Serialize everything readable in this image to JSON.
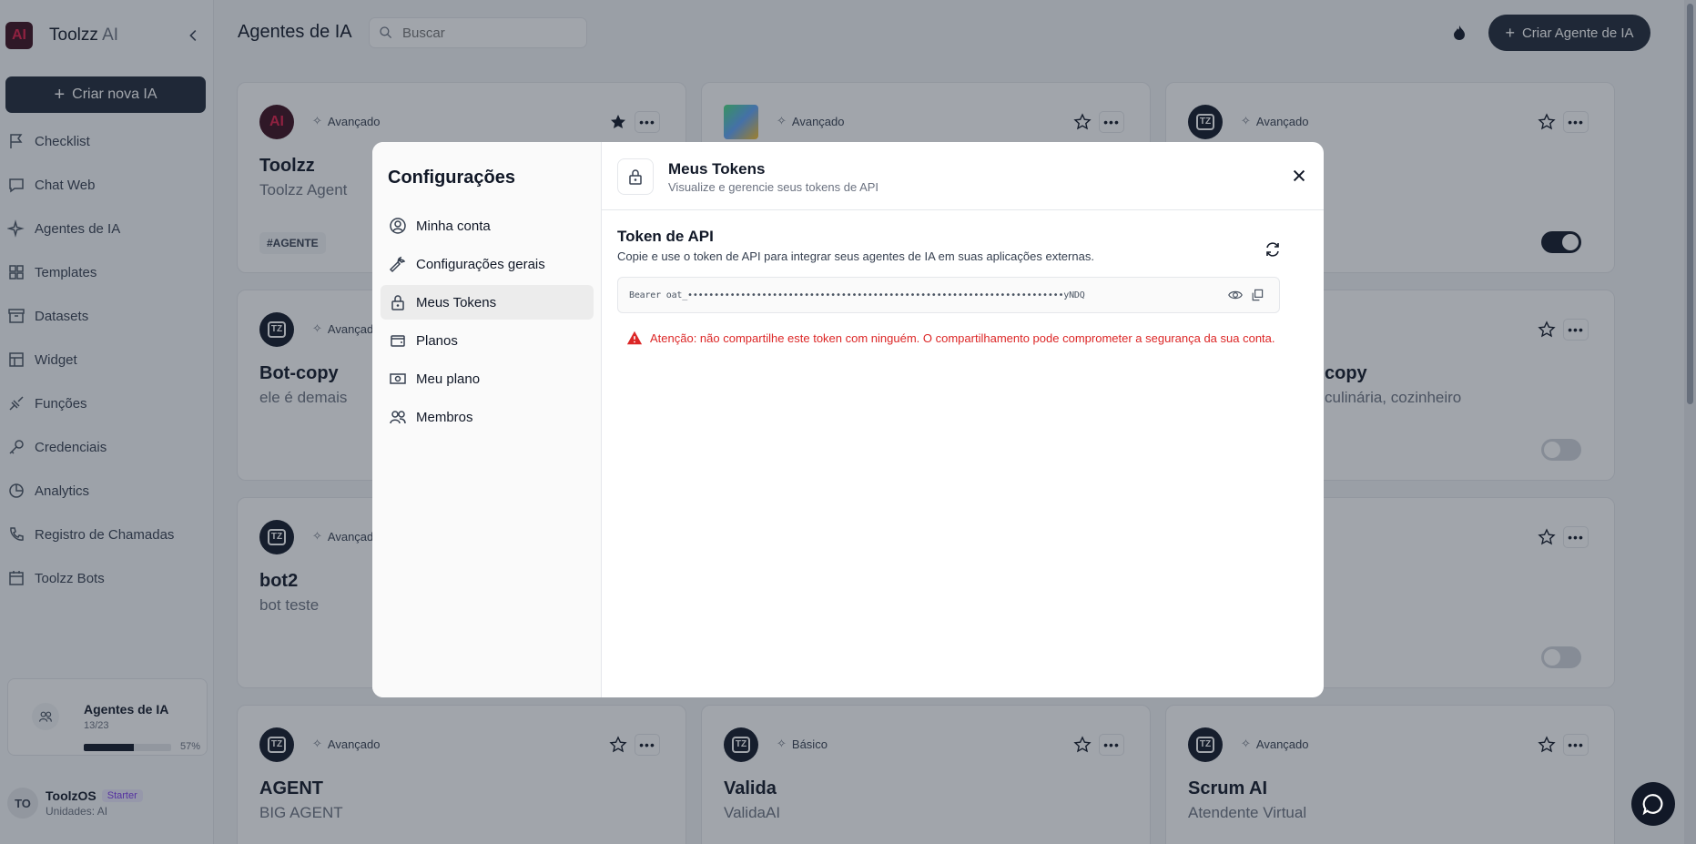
{
  "sidebar": {
    "brand": {
      "logo": "AI",
      "name": "Toolzz",
      "suffix": "AI"
    },
    "create_button": "Criar nova IA",
    "items": [
      {
        "label": "Checklist",
        "icon": "flag-icon"
      },
      {
        "label": "Chat Web",
        "icon": "chat-icon"
      },
      {
        "label": "Agentes de IA",
        "icon": "sparkles-icon"
      },
      {
        "label": "Templates",
        "icon": "grid-icon"
      },
      {
        "label": "Datasets",
        "icon": "archive-icon"
      },
      {
        "label": "Widget",
        "icon": "widget-icon"
      },
      {
        "label": "Funções",
        "icon": "function-icon"
      },
      {
        "label": "Credenciais",
        "icon": "key-icon"
      },
      {
        "label": "Analytics",
        "icon": "chart-pie-icon"
      },
      {
        "label": "Registro de Chamadas",
        "icon": "phone-icon"
      },
      {
        "label": "Toolzz Bots",
        "icon": "calendar-icon"
      }
    ],
    "usage": {
      "title": "Agentes de IA",
      "count": "13/23",
      "percent": "57%",
      "fraction": 0.57
    },
    "user": {
      "initials": "TO",
      "name": "ToolzOS",
      "badge": "Starter",
      "unit": "Unidades: AI"
    }
  },
  "header": {
    "title": "Agentes de IA",
    "search_placeholder": "Buscar",
    "create_button": "Criar Agente de IA"
  },
  "cards": [
    {
      "avatar": "AI",
      "level": "Avançado",
      "name": "Toolzz",
      "desc": "Toolzz Agent",
      "tag": "#AGENTE",
      "starred": true
    },
    {
      "avatar": "img",
      "level": "Avançado",
      "name": "",
      "desc": "",
      "tag": "",
      "starred": false
    },
    {
      "avatar": "TZ",
      "level": "Avançado",
      "name": "",
      "desc": "",
      "tag": "",
      "starred": false,
      "toggle": true
    },
    {
      "avatar": "TZ",
      "level": "Avançado",
      "name": "Bot-copy",
      "desc": "ele é demais",
      "starred": false
    },
    {
      "avatar": "",
      "level": "",
      "name": "copy",
      "desc": "culinária, cozinheiro",
      "starred": false,
      "toggle": false
    },
    {
      "avatar": "TZ",
      "level": "Avançado",
      "name": "bot2",
      "desc": "bot teste",
      "starred": false
    },
    {
      "avatar": "",
      "level": "",
      "name": "",
      "desc": "",
      "starred": false,
      "toggle": false
    },
    {
      "avatar": "TZ",
      "level": "Avançado",
      "name": "AGENT",
      "desc": "BIG AGENT",
      "starred": false
    },
    {
      "avatar": "TZ",
      "level": "Básico",
      "name": "Valida",
      "desc": "ValidaAI",
      "starred": false
    },
    {
      "avatar": "TZ",
      "level": "Avançado",
      "name": "Scrum AI",
      "desc": "Atendente Virtual",
      "starred": false
    }
  ],
  "modal": {
    "side_title": "Configurações",
    "menu": [
      {
        "label": "Minha conta",
        "icon": "user-circle-icon"
      },
      {
        "label": "Configurações gerais",
        "icon": "wrench-icon"
      },
      {
        "label": "Meus Tokens",
        "icon": "lock-icon",
        "active": true
      },
      {
        "label": "Planos",
        "icon": "wallet-icon"
      },
      {
        "label": "Meu plano",
        "icon": "money-icon"
      },
      {
        "label": "Membros",
        "icon": "users-icon"
      }
    ],
    "title": "Meus Tokens",
    "subtitle": "Visualize e gerencie seus tokens de API",
    "section_title": "Token de API",
    "section_desc": "Copie e use o token de API para integrar seus agentes de IA em suas aplicações externas.",
    "token": "Bearer oat_•••••••••••••••••••••••••••••••••••••••••••••••••••••••••••••••••••••••yNDQ",
    "warning": "Atenção: não compartilhe este token com ninguém. O compartilhamento pode comprometer a segurança da sua conta."
  }
}
